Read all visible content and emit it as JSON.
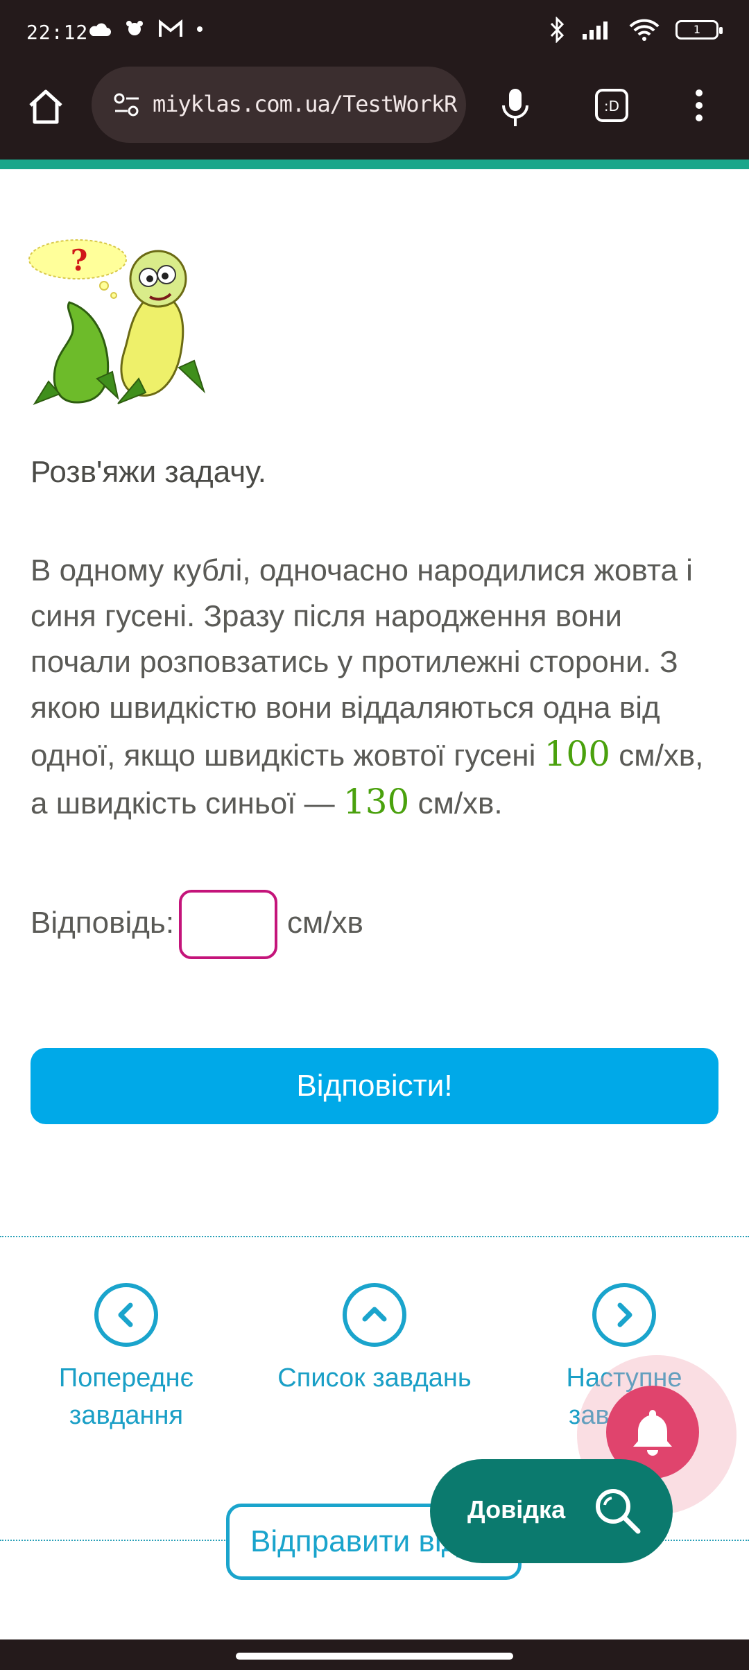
{
  "status_bar": {
    "time": "22:12",
    "battery": "1"
  },
  "browser": {
    "url": "miyklas.com.ua/TestWorkRu"
  },
  "task": {
    "heading": "Розв'яжи задачу.",
    "text_part1": "В одному кублі, одночасно народилися жовта і синя гусені. Зразу після народження вони почали розповзатись у протилежні сторони. З якою швидкістю вони віддаляються одна від одної, якщо швидкість жовтої гусені ",
    "value1": "100",
    "text_part2": " см/хв, а швидкість синьої — ",
    "value2": "130",
    "text_part3": " см/хв."
  },
  "answer": {
    "label": "Відповідь:",
    "value": "",
    "unit": "см/хв"
  },
  "submit_label": "Відповісти!",
  "nav": {
    "prev_line1": "Попереднє",
    "prev_line2": "завдання",
    "list_label": "Список завдань",
    "next_line1": "Наступне",
    "next_line2": "зав"
  },
  "send_label": "Відправити від",
  "help_label": "Довідка",
  "colors": {
    "accent_line": "#1aa68a",
    "submit_button": "#00a9e8",
    "input_border": "#c4147a",
    "number_highlight": "#4aa10d",
    "help_button": "#0b7a6e",
    "bell_button": "#e0446d"
  }
}
